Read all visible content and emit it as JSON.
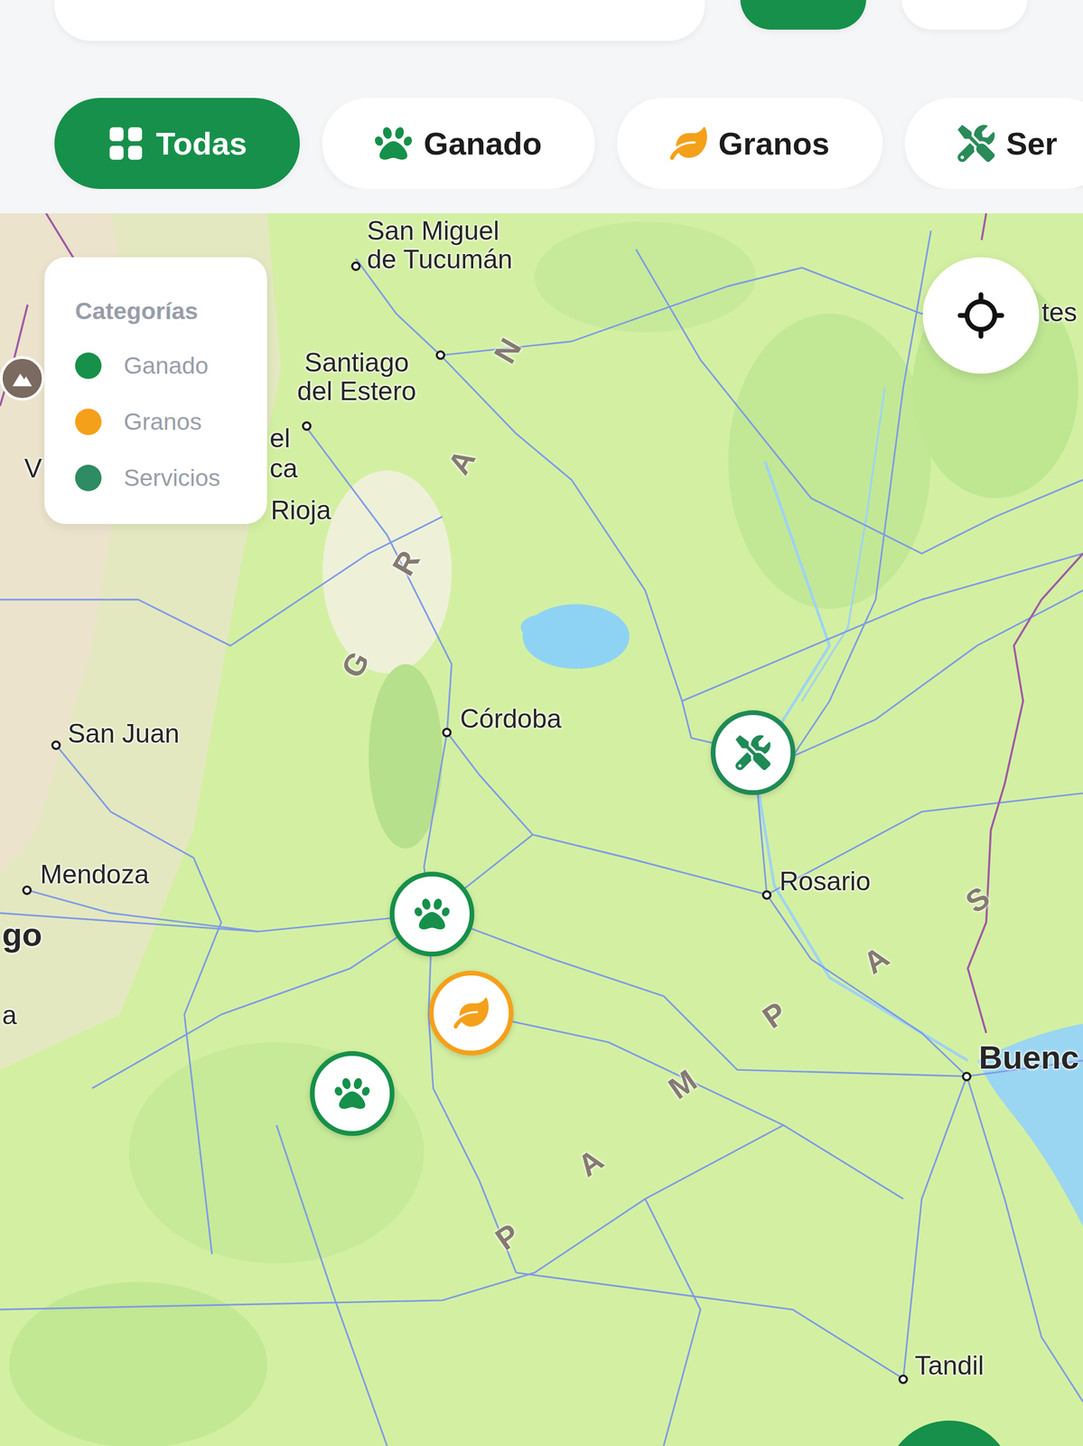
{
  "filters": [
    {
      "label": "Todas",
      "kind": "all",
      "selected": true,
      "color": "#16904a"
    },
    {
      "label": "Ganado",
      "kind": "ganado",
      "selected": false,
      "color": "#16904a"
    },
    {
      "label": "Granos",
      "kind": "granos",
      "selected": false,
      "color": "#f5a01b"
    },
    {
      "label": "Ser",
      "kind": "servicios",
      "selected": false,
      "color": "#2a8a58"
    }
  ],
  "legend": {
    "title": "Categorías",
    "items": [
      {
        "label": "Ganado",
        "color": "#16904a"
      },
      {
        "label": "Granos",
        "color": "#f5a01b"
      },
      {
        "label": "Servicios",
        "color": "#2e8b62"
      }
    ]
  },
  "map": {
    "labels": [
      {
        "lines": [
          "San Miguel",
          "de Tucumán"
        ],
        "kind": "city"
      },
      {
        "lines": [
          "Santiago",
          "del Estero"
        ],
        "kind": "city"
      },
      {
        "lines": [
          "el"
        ],
        "kind": "city"
      },
      {
        "lines": [
          "ca"
        ],
        "kind": "fragment"
      },
      {
        "lines": [
          "Rioja"
        ],
        "kind": "fragment"
      },
      {
        "lines": [
          "V"
        ],
        "kind": "fragment"
      },
      {
        "lines": [
          "San Juan"
        ],
        "kind": "city"
      },
      {
        "lines": [
          "Mendoza"
        ],
        "kind": "city"
      },
      {
        "lines": [
          "go"
        ],
        "kind": "capital"
      },
      {
        "lines": [
          "a"
        ],
        "kind": "fragment"
      },
      {
        "lines": [
          "Córdoba"
        ],
        "kind": "city"
      },
      {
        "lines": [
          "Rosario"
        ],
        "kind": "city"
      },
      {
        "lines": [
          "Buenc"
        ],
        "kind": "capital"
      },
      {
        "lines": [
          "Tandil"
        ],
        "kind": "city"
      },
      {
        "lines": [
          "tes"
        ],
        "kind": "fragment"
      }
    ],
    "regions": [
      {
        "text": "GRAN"
      },
      {
        "text": "PAMPAS"
      }
    ],
    "pins": [
      {
        "kind": "servicios",
        "color": "#1f8a55"
      },
      {
        "kind": "ganado",
        "color": "#16904a"
      },
      {
        "kind": "granos",
        "color": "#f5a01b"
      },
      {
        "kind": "ganado",
        "color": "#16904a"
      }
    ]
  }
}
